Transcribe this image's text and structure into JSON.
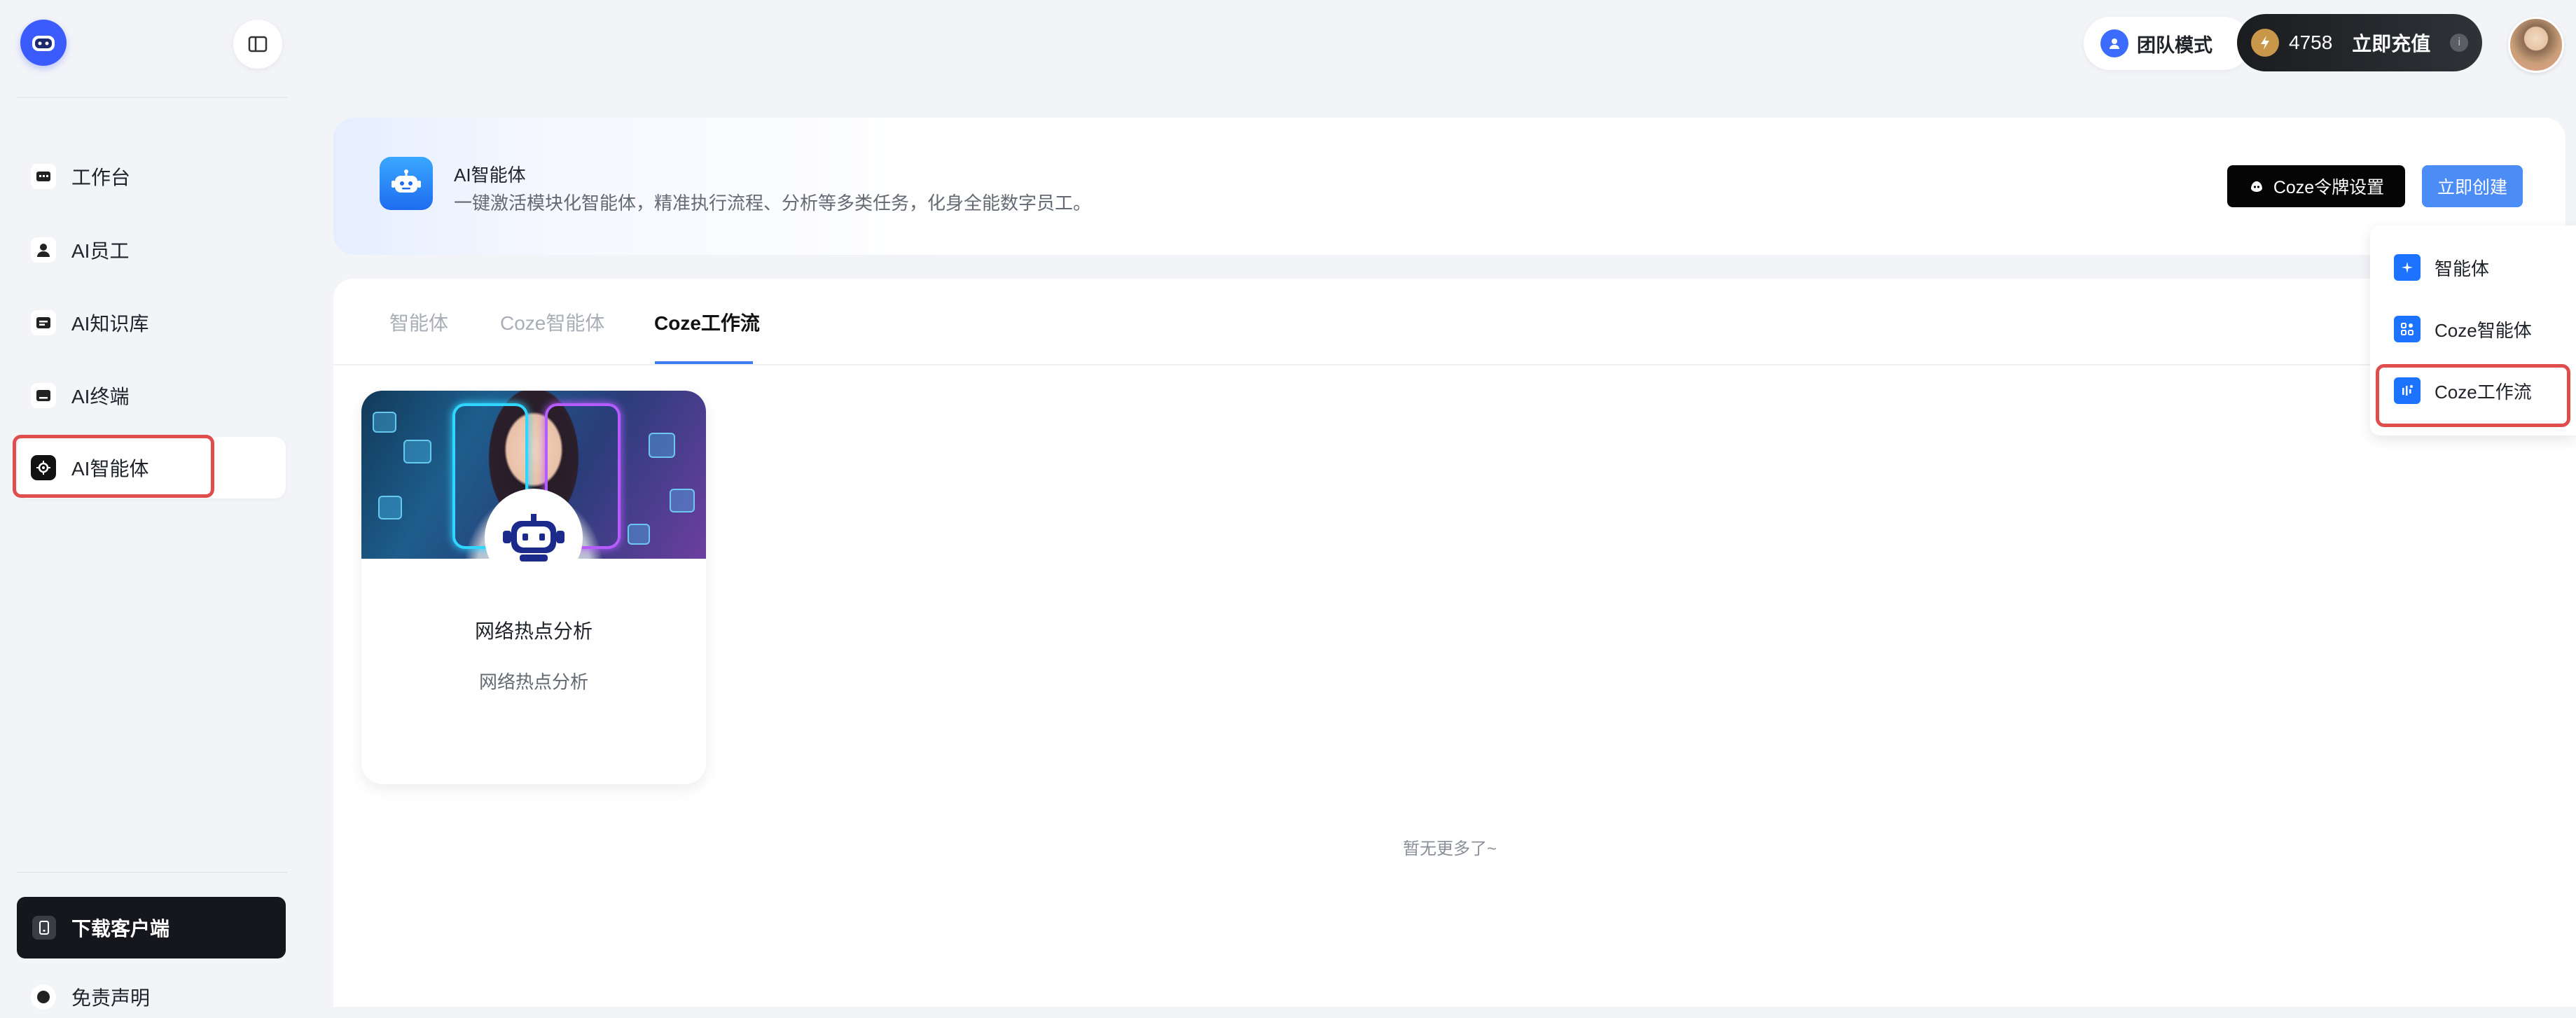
{
  "sidebar": {
    "items": [
      {
        "label": "工作台",
        "icon": "workbench-icon"
      },
      {
        "label": "AI员工",
        "icon": "person-icon"
      },
      {
        "label": "AI知识库",
        "icon": "knowledge-icon"
      },
      {
        "label": "AI终端",
        "icon": "terminal-icon"
      },
      {
        "label": "AI智能体",
        "icon": "agent-icon",
        "active": true
      }
    ],
    "download_label": "下载客户端",
    "disclaimer_label": "免责声明"
  },
  "topbar": {
    "team_mode_label": "团队模式",
    "credits": "4758",
    "recharge_label": "立即充值",
    "info_glyph": "i"
  },
  "header": {
    "title": "AI智能体",
    "description": "一键激活模块化智能体，精准执行流程、分析等多类任务，化身全能数字员工。",
    "coze_settings_label": "Coze令牌设置",
    "create_label": "立即创建"
  },
  "tabs": [
    {
      "label": "智能体",
      "active": false
    },
    {
      "label": "Coze智能体",
      "active": false
    },
    {
      "label": "Coze工作流",
      "active": true
    }
  ],
  "cards": [
    {
      "title": "网络热点分析",
      "subtitle": "网络热点分析"
    }
  ],
  "empty_hint": "暂无更多了~",
  "dropdown": {
    "items": [
      {
        "label": "智能体",
        "icon": "sparkle-icon"
      },
      {
        "label": "Coze智能体",
        "icon": "grid-icon"
      },
      {
        "label": "Coze工作流",
        "icon": "workflow-icon",
        "highlighted": true
      }
    ]
  },
  "colors": {
    "accent": "#3c7ef6",
    "create_button": "#4c8cf5",
    "highlight_border": "#e04d4d",
    "dark_button": "#050505"
  }
}
